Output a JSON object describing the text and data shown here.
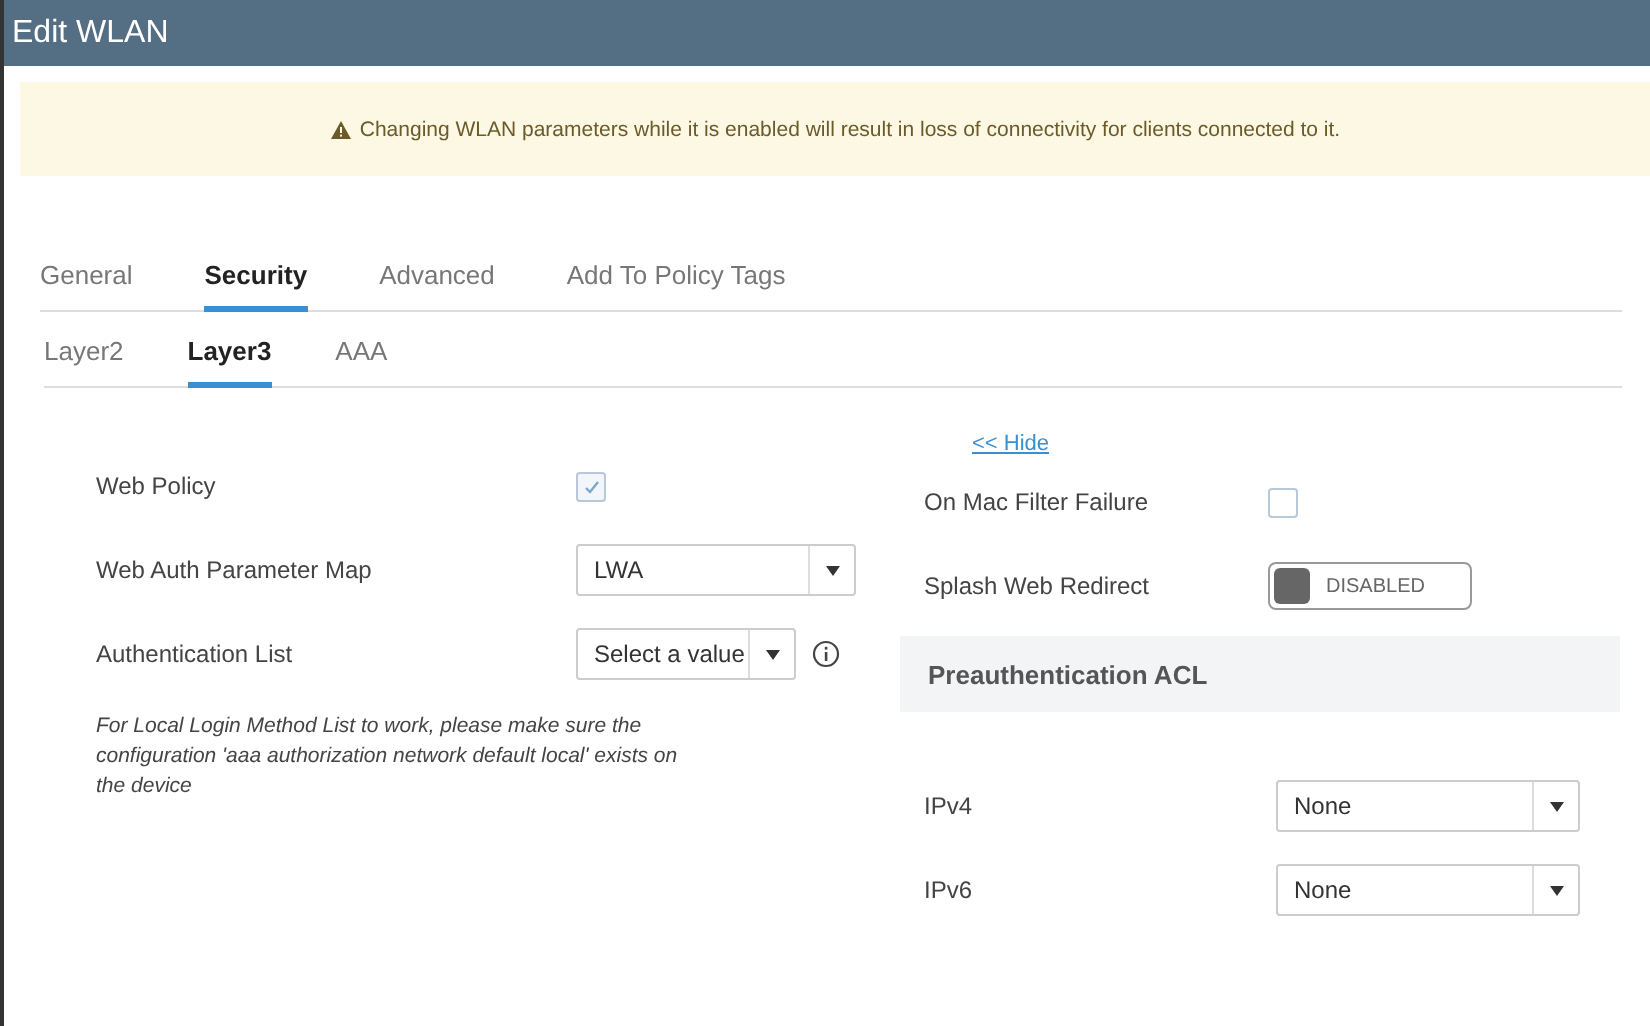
{
  "window": {
    "title": "Edit WLAN"
  },
  "warning": "Changing WLAN parameters while it is enabled will result in loss of connectivity for clients connected to it.",
  "tabs": [
    {
      "label": "General",
      "selected": false
    },
    {
      "label": "Security",
      "selected": true
    },
    {
      "label": "Advanced",
      "selected": false
    },
    {
      "label": "Add To Policy Tags",
      "selected": false
    }
  ],
  "subtabs": [
    {
      "label": "Layer2",
      "selected": false
    },
    {
      "label": "Layer3",
      "selected": true
    },
    {
      "label": "AAA",
      "selected": false
    }
  ],
  "left_fields": [
    {
      "kind": "checkbox",
      "label": "Web Policy",
      "checked": true
    },
    {
      "kind": "select",
      "label": "Web Auth Parameter Map",
      "value": "LWA"
    },
    {
      "kind": "select-info",
      "label": "Authentication List",
      "value": "Select a value"
    }
  ],
  "note": "For Local Login Method List to work, please make sure the configuration 'aaa authorization network default local' exists on the device",
  "hide_link": "<< Hide",
  "right_fields": [
    {
      "kind": "checkbox",
      "label": "On Mac Filter Failure",
      "checked": false
    },
    {
      "kind": "toggle",
      "label": "Splash Web Redirect",
      "on": false,
      "value": "DISABLED"
    }
  ],
  "preauth": {
    "title": "Preauthentication ACL",
    "fields": [
      {
        "kind": "select",
        "label": "IPv4",
        "value": "None"
      },
      {
        "kind": "select",
        "label": "IPv6",
        "value": "None"
      }
    ]
  }
}
